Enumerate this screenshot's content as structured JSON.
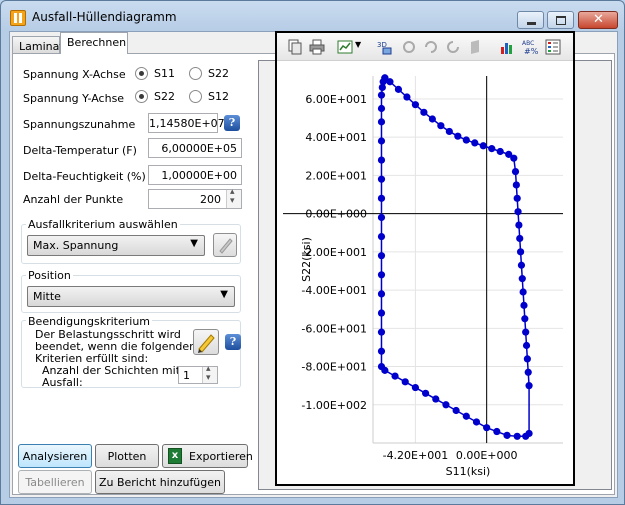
{
  "window": {
    "title": "Ausfall-Hüllendiagramm"
  },
  "tabs": [
    {
      "label": "Laminat"
    },
    {
      "label": "Berechnen"
    }
  ],
  "form": {
    "x_axis_label": "Spannung X-Achse",
    "x_axis_options": [
      "S11",
      "S22"
    ],
    "x_axis_selected": "S11",
    "y_axis_label": "Spannung Y-Achse",
    "y_axis_options": [
      "S22",
      "S12"
    ],
    "y_axis_selected": "S22",
    "stress_increment_label": "Spannungszunahme",
    "stress_increment_value": "1,14580E+07",
    "delta_temp_label": "Delta-Temperatur (F)",
    "delta_temp_value": "6,00000E+05",
    "delta_moisture_label": "Delta-Feuchtigkeit (%)",
    "delta_moisture_value": "1,00000E+00",
    "num_points_label": "Anzahl der Punkte",
    "num_points_value": "200"
  },
  "failure_group": {
    "title": "Ausfallkriterium auswählen",
    "selected": "Max. Spannung"
  },
  "position_group": {
    "title": "Position",
    "selected": "Mitte"
  },
  "termination_group": {
    "title": "Beendigungskriterium",
    "text_line1": "Der Belastungsschritt wird",
    "text_line2": "beendet, wenn die folgenden",
    "text_line3": "Kriterien erfüllt sind:",
    "layers_label_line1": "Anzahl der Schichten mit",
    "layers_label_line2": "Ausfall:",
    "layers_value": "1"
  },
  "buttons": {
    "analyze": "Analysieren",
    "plot": "Plotten",
    "export": "Exportieren",
    "tabulate": "Tabellieren",
    "add_to_report": "Zu Bericht hinzufügen"
  },
  "chart_data": {
    "type": "line",
    "xlabel": "S11(ksi)",
    "ylabel": "S22(ksi)",
    "x_ticks": [
      "-4.20E+001",
      "0.00E+000"
    ],
    "y_ticks": [
      "6.00E+001",
      "4.00E+001",
      "2.00E+001",
      "0.00E+000",
      "-2.00E+001",
      "-4.00E+001",
      "-6.00E+001",
      "-8.00E+001",
      "-1.00E+002"
    ],
    "xlim": [
      -67,
      45
    ],
    "ylim": [
      -120,
      72
    ],
    "series": [
      {
        "color": "#0000cc",
        "x": [
          -60,
          -57,
          -52,
          -47,
          -42,
          -37,
          -32,
          -27,
          -22,
          -17,
          -12,
          -7,
          -2,
          3,
          8,
          13,
          16,
          17,
          17.5,
          18,
          18.5,
          19,
          19.5,
          20,
          20.5,
          21,
          21.5,
          22,
          22.5,
          23,
          23.5,
          24,
          24.5,
          25,
          25,
          23,
          18,
          12,
          6,
          0,
          -6,
          -12,
          -18,
          -24,
          -30,
          -36,
          -42,
          -48,
          -54,
          -60,
          -62,
          -62,
          -62,
          -62,
          -62,
          -62,
          -62,
          -62,
          -62,
          -62,
          -62,
          -62,
          -62,
          -62,
          -62,
          -62,
          -61.5,
          -61,
          -60
        ],
        "y": [
          71,
          69,
          65,
          61,
          57,
          53,
          49.5,
          46,
          43,
          40.5,
          38.5,
          37,
          35.5,
          34,
          32.5,
          31,
          29,
          22,
          15,
          8,
          1,
          -6,
          -13,
          -20,
          -27,
          -34,
          -41,
          -48,
          -55,
          -62,
          -69,
          -76,
          -83,
          -90,
          -115,
          -116.5,
          -116.5,
          -116,
          -114,
          -112,
          -109,
          -106,
          -103,
          -100,
          -97,
          -94,
          -91,
          -88,
          -85,
          -82,
          -80,
          -72,
          -62,
          -52,
          -42,
          -32,
          -22,
          -12,
          -2,
          8,
          18,
          28,
          38,
          48,
          55,
          62,
          66,
          69,
          71
        ]
      }
    ],
    "grid": true,
    "legend": "none"
  }
}
